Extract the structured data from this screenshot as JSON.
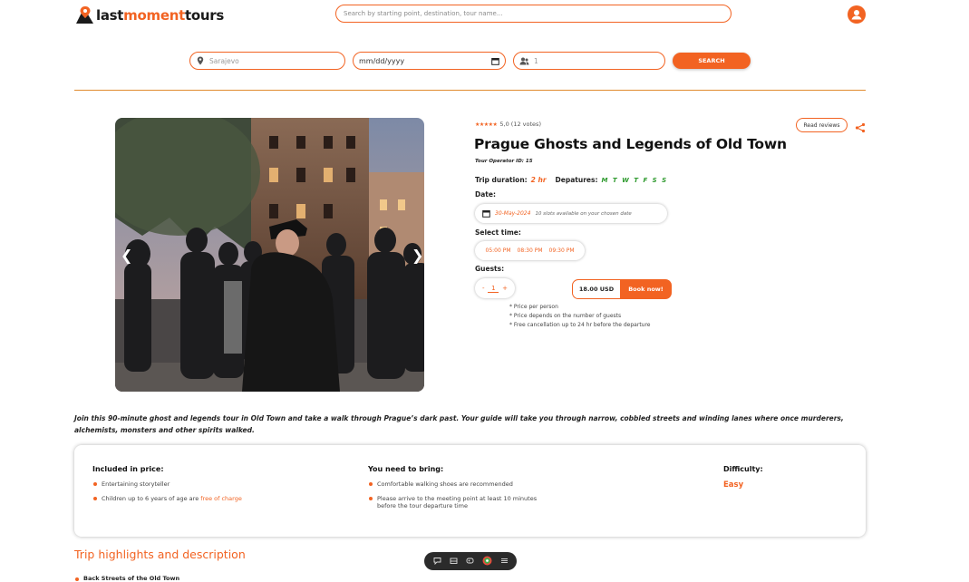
{
  "header": {
    "logo_part1": "last",
    "logo_part2": "moment",
    "logo_part3": "tours",
    "search_placeholder": "Search by starting point, destination, tour name..."
  },
  "filters": {
    "location_placeholder": "Sarajevo",
    "date_placeholder": "mm/dd/yyyy",
    "guests_placeholder": "1",
    "search_label": "SEARCH"
  },
  "tour": {
    "rating_text": "5,0 (12 votes)",
    "read_reviews_label": "Read reviews",
    "title": "Prague Ghosts and Legends of Old Town",
    "operator": "Tour Operator ID: 15",
    "duration_label": "Trip duration:",
    "duration_value": "2 hr",
    "departures_label": "Depatures:",
    "departures_days": "M T W T F S S",
    "date_label": "Date:",
    "date_value": "30-May-2024",
    "date_slots": "10 slots available on your chosen date",
    "time_label": "Select time:",
    "times": [
      "05:00 PM",
      "08:30 PM",
      "09:30 PM"
    ],
    "guests_label": "Guests:",
    "qty_minus": "-",
    "qty_value": "1",
    "qty_plus": "+",
    "price": "18.00 USD",
    "book_label": "Book now!",
    "notes": [
      "* Price per person",
      "* Price depends on the number of guests",
      "* Free cancellation up to 24 hr before the departure"
    ],
    "description": "Join this 90-minute ghost and legends tour in Old Town and take a walk through Prague’s dark past. Your guide will take you through narrow, cobbled streets and winding lanes where once murderers, alchemists, monsters and other spirits walked."
  },
  "info": {
    "included_title": "Included in price:",
    "included_1": "Entertaining storyteller",
    "included_2_pre": "Children up to 6 years of age are ",
    "included_2_hl": "free of charge",
    "bring_title": "You need to bring:",
    "bring_1": "Comfortable walking shoes are recommended",
    "bring_2a": "Please arrive to the meeting point at least 10 minutes",
    "bring_2b": "before the tour departure time",
    "difficulty_title": "Difficulty:",
    "difficulty_value": "Easy"
  },
  "highlights": {
    "title": "Trip highlights and description",
    "first_item": "Back Streets of the Old Town"
  },
  "colors": {
    "accent": "#f26322",
    "green": "#2e9a2e"
  }
}
